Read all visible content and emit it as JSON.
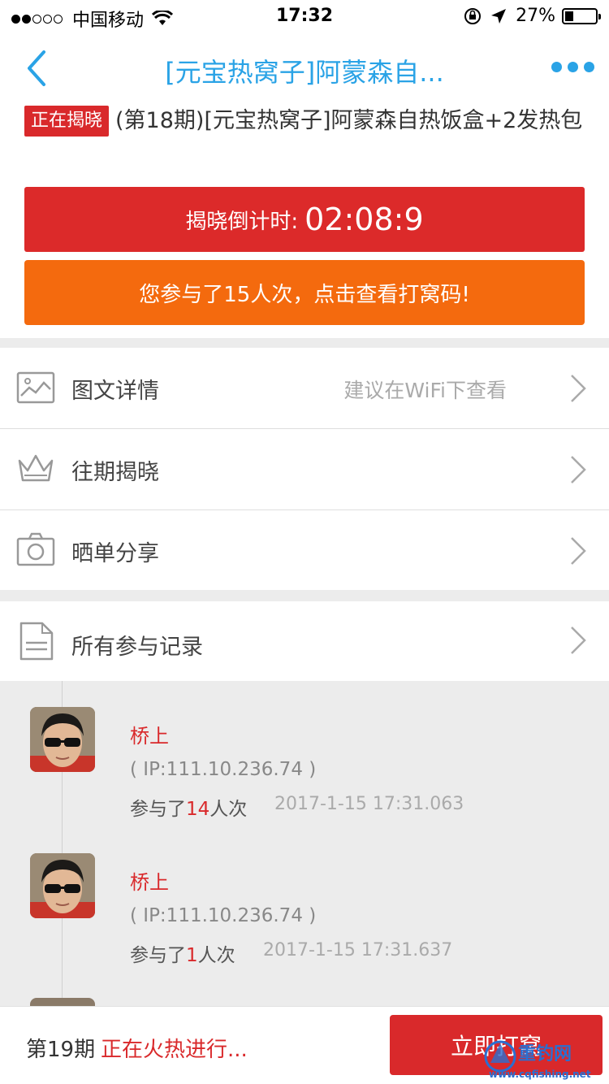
{
  "status_bar": {
    "carrier": "中国移动",
    "time": "17:32",
    "battery": "27%",
    "battery_level": 0.27
  },
  "nav": {
    "title": "[元宝热窝子]阿蒙森自..."
  },
  "product": {
    "tag": "正在揭晓",
    "title": "(第18期)[元宝热窝子]阿蒙森自热饭盒+2发热包"
  },
  "countdown": {
    "label": "揭晓倒计时:",
    "value": "02:08:9"
  },
  "join_button": "您参与了15人次，点击查看打窝码!",
  "menu": {
    "details": {
      "label": "图文详情",
      "hint": "建议在WiFi下查看"
    },
    "history": {
      "label": "往期揭晓"
    },
    "share": {
      "label": "晒单分享"
    },
    "records": {
      "label": "所有参与记录"
    }
  },
  "records": [
    {
      "name": "桥上",
      "ip": "( IP:111.10.236.74 )",
      "prefix": "参与了",
      "count": "14",
      "suffix": "人次",
      "time": "2017-1-15 17:31.063"
    },
    {
      "name": "桥上",
      "ip": "( IP:111.10.236.74 )",
      "prefix": "参与了",
      "count": "1",
      "suffix": "人次",
      "time": "2017-1-15 17:31.637"
    }
  ],
  "bottom": {
    "period": "第19期",
    "status": "正在火热进行...",
    "button": "立即打窝"
  },
  "watermark": {
    "name": "重钓网",
    "url": "www.cqfishing.net"
  },
  "colors": {
    "accent_blue": "#2aa3e6",
    "red": "#dc2a2a",
    "orange": "#f46a0e"
  }
}
